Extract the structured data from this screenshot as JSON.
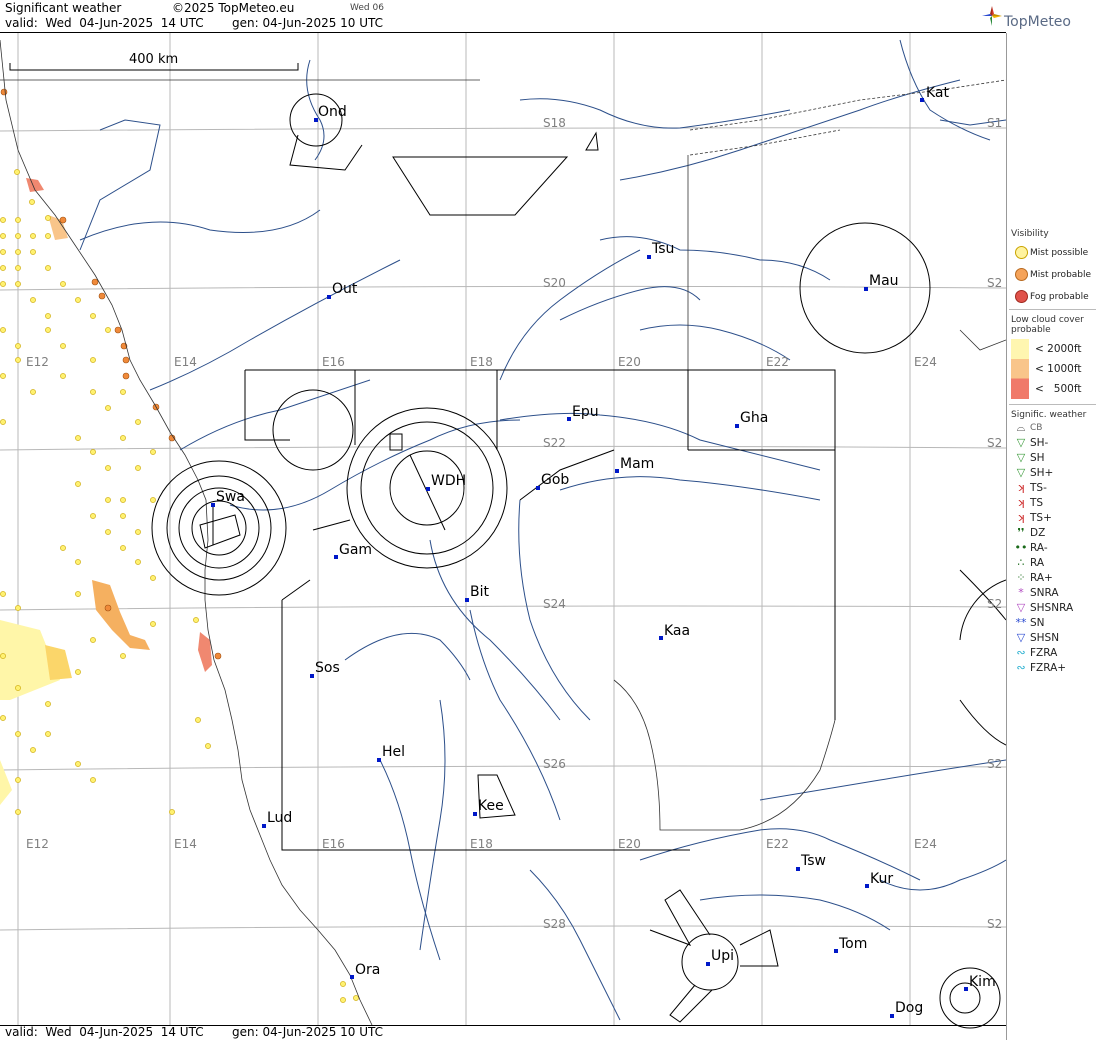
{
  "header": {
    "title": "Significant weather",
    "copyright": "©2025 TopMeteo.eu",
    "day_small": "Wed 06",
    "valid": "valid:  Wed  04-Jun-2025  14 UTC",
    "generated": "gen: 04-Jun-2025 10 UTC",
    "brand": "TopMeteo"
  },
  "footer": {
    "valid": "valid:  Wed  04-Jun-2025  14 UTC",
    "generated": "gen: 04-Jun-2025 10 UTC"
  },
  "scale_bar": {
    "label": "400 km"
  },
  "grid": {
    "lon_labels": [
      "E12",
      "E14",
      "E16",
      "E18",
      "E20",
      "E22",
      "E24"
    ],
    "lat_labels": [
      "S18",
      "S20",
      "S22",
      "S24",
      "S26",
      "S28"
    ],
    "edge_lat_labels": [
      "S1",
      "S2",
      "S2",
      "S2",
      "S2",
      "S2"
    ]
  },
  "stations": [
    {
      "code": "Ond"
    },
    {
      "code": "Kat"
    },
    {
      "code": "Tsu"
    },
    {
      "code": "Out"
    },
    {
      "code": "Mau"
    },
    {
      "code": "Epu"
    },
    {
      "code": "Gha"
    },
    {
      "code": "Mam"
    },
    {
      "code": "Gob"
    },
    {
      "code": "WDH"
    },
    {
      "code": "Swa"
    },
    {
      "code": "Gam"
    },
    {
      "code": "Bit"
    },
    {
      "code": "Kaa"
    },
    {
      "code": "Sos"
    },
    {
      "code": "Hel"
    },
    {
      "code": "Kee"
    },
    {
      "code": "Lud"
    },
    {
      "code": "Tsw"
    },
    {
      "code": "Kur"
    },
    {
      "code": "Tom"
    },
    {
      "code": "Upi"
    },
    {
      "code": "Ora"
    },
    {
      "code": "Kim"
    },
    {
      "code": "Dog"
    }
  ],
  "legend": {
    "visibility": {
      "title": "Visibility",
      "items": [
        {
          "label": "Mist possible",
          "color": "#fff3a0"
        },
        {
          "label": "Mist probable",
          "color": "#f5a35a"
        },
        {
          "label": "Fog probable",
          "color": "#e0524a"
        }
      ]
    },
    "low_cloud": {
      "title": "Low cloud cover probable",
      "items": [
        {
          "label": "< 2000ft",
          "color": "#fff6b0"
        },
        {
          "label": "< 1000ft",
          "color": "#f9c58a"
        },
        {
          "label": "<   500ft",
          "color": "#f07a6a"
        }
      ]
    },
    "significant_weather": {
      "title": "Signific. weather",
      "items": [
        {
          "label": "CB",
          "icon": "cb-icon",
          "color": "#555555"
        },
        {
          "label": "SH-",
          "icon": "shower-light-icon",
          "color": "#3a9a3a"
        },
        {
          "label": "SH",
          "icon": "shower-icon",
          "color": "#3a9a3a"
        },
        {
          "label": "SH+",
          "icon": "shower-heavy-icon",
          "color": "#3a9a3a"
        },
        {
          "label": "TS-",
          "icon": "thunderstorm-light-icon",
          "color": "#cc2222"
        },
        {
          "label": "TS",
          "icon": "thunderstorm-icon",
          "color": "#cc2222"
        },
        {
          "label": "TS+",
          "icon": "thunderstorm-heavy-icon",
          "color": "#cc2222"
        },
        {
          "label": "DZ",
          "icon": "drizzle-icon",
          "color": "#1a6a1a"
        },
        {
          "label": "RA-",
          "icon": "rain-light-icon",
          "color": "#1a6a1a"
        },
        {
          "label": "RA",
          "icon": "rain-icon",
          "color": "#1a6a1a"
        },
        {
          "label": "RA+",
          "icon": "rain-heavy-icon",
          "color": "#1a6a1a"
        },
        {
          "label": "SNRA",
          "icon": "snow-rain-icon",
          "color": "#b04ac0"
        },
        {
          "label": "SHSNRA",
          "icon": "shower-snow-rain-icon",
          "color": "#b04ac0"
        },
        {
          "label": "SN",
          "icon": "snow-icon",
          "color": "#2a4ad0"
        },
        {
          "label": "SHSN",
          "icon": "shower-snow-icon",
          "color": "#2a4ad0"
        },
        {
          "label": "FZRA",
          "icon": "freezing-rain-icon",
          "color": "#2ab0d0"
        },
        {
          "label": "FZRA+",
          "icon": "freezing-rain-heavy-icon",
          "color": "#2ab0d0"
        }
      ]
    }
  }
}
